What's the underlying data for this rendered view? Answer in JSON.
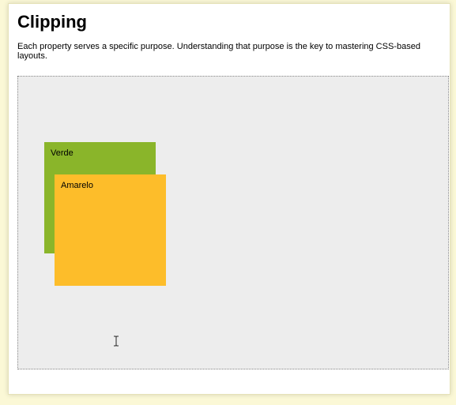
{
  "page": {
    "title": "Clipping",
    "description": "Each property serves a specific purpose. Understanding that purpose is the key to mastering CSS-based layouts."
  },
  "demo": {
    "boxes": [
      {
        "label": "Verde",
        "color": "#8ab52a"
      },
      {
        "label": "Amarelo",
        "color": "#fdbd2a"
      }
    ],
    "cursor": "text-cursor-icon"
  }
}
